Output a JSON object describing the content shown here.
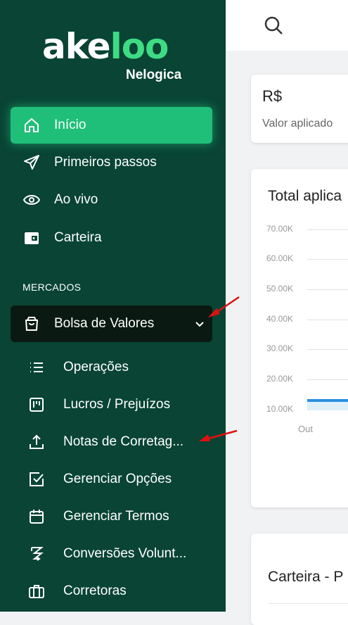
{
  "logo": {
    "part1": "ake",
    "part2": "loo",
    "sub": "Nelogica"
  },
  "nav": [
    {
      "label": "Início",
      "icon": "home-icon"
    },
    {
      "label": "Primeiros passos",
      "icon": "send-icon"
    },
    {
      "label": "Ao vivo",
      "icon": "eye-icon"
    },
    {
      "label": "Carteira",
      "icon": "wallet-icon"
    }
  ],
  "section": "MERCADOS",
  "market": {
    "label": "Bolsa de Valores",
    "icon": "shopping-bag-icon"
  },
  "submenu": [
    {
      "label": "Operações",
      "icon": "list-icon"
    },
    {
      "label": "Lucros / Prejuízos",
      "icon": "kanban-icon"
    },
    {
      "label": "Notas de Corretag...",
      "icon": "upload-icon"
    },
    {
      "label": "Gerenciar Opções",
      "icon": "checkbox-icon"
    },
    {
      "label": "Gerenciar Termos",
      "icon": "calendar-icon"
    },
    {
      "label": "Conversões Volunt...",
      "icon": "convert-icon"
    },
    {
      "label": "Corretoras",
      "icon": "briefcase-icon"
    }
  ],
  "summary": {
    "currency": "R$",
    "label": "Valor aplicado"
  },
  "chart_data": {
    "type": "line",
    "title": "Total aplica",
    "y_ticks": [
      "70.00K",
      "60.00K",
      "50.00K",
      "40.00K",
      "30.00K",
      "20.00K",
      "10.00K"
    ],
    "x_ticks": [
      "Out"
    ],
    "ylim": [
      10000,
      70000
    ],
    "grid": true
  },
  "portfolio": {
    "title": "Carteira - P"
  },
  "colors": {
    "sidebar": "#094434",
    "active": "#1fbf7a",
    "accent_logo": "#3ddc84",
    "series": "#2a8fe0"
  }
}
